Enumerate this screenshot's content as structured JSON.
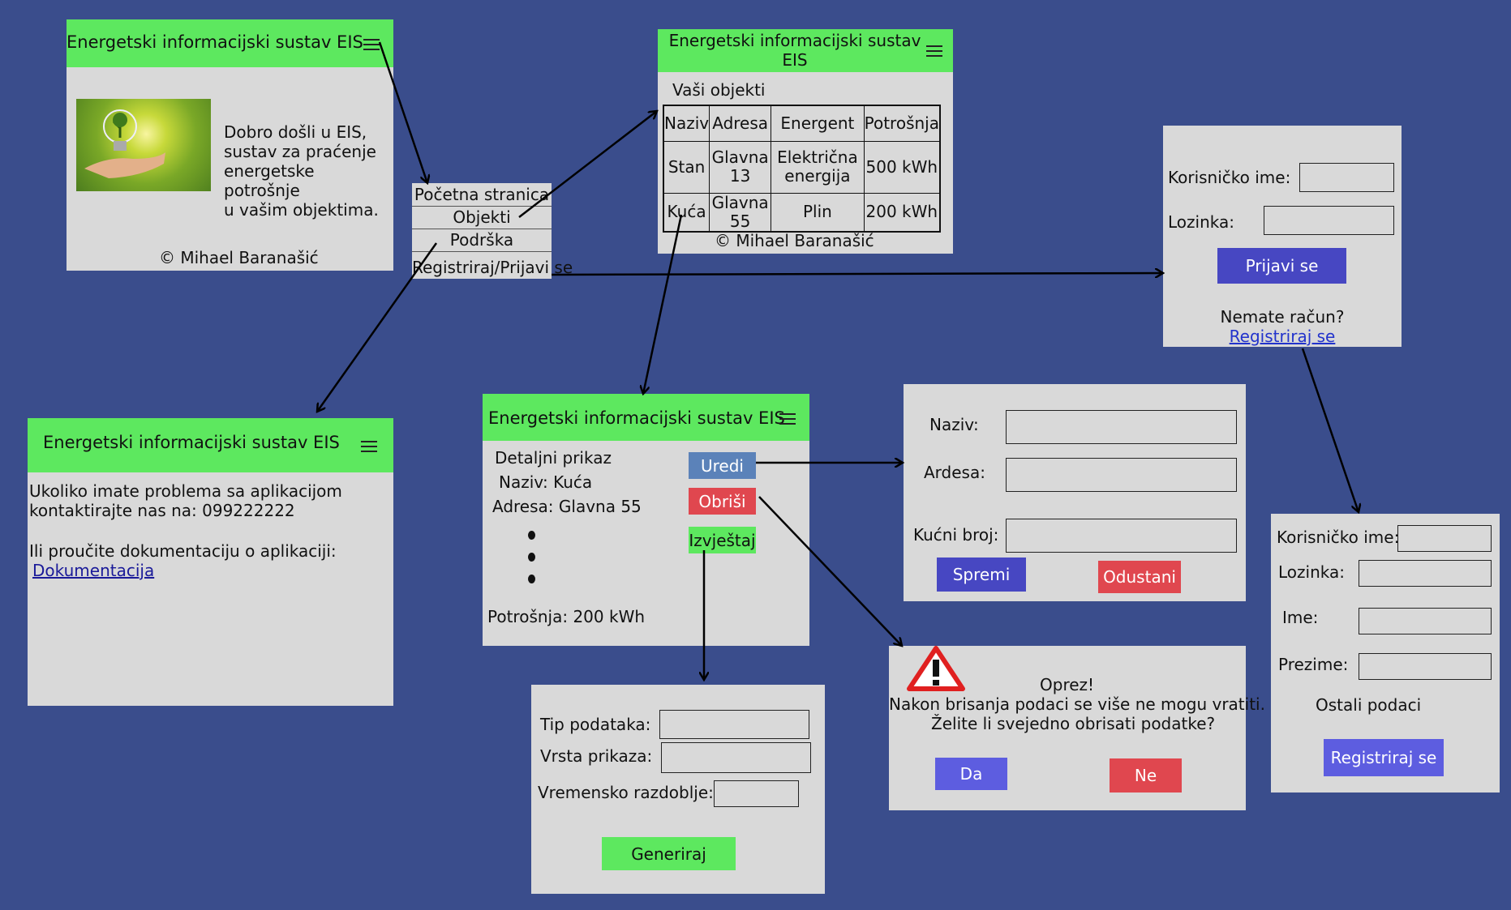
{
  "app_title": "Energetski informacijski sustav EIS",
  "copyright": "© Mihael Baranašić",
  "home": {
    "welcome": [
      "Dobro došli u EIS,",
      "sustav za praćenje",
      "energetske potrošnje",
      "u vašim objektima."
    ],
    "image_icon": "lightbulb-plant-image"
  },
  "nav_menu": {
    "items": [
      "Početna stranica",
      "Objekti",
      "Podrška",
      "Registriraj/Prijavi se"
    ]
  },
  "objects": {
    "title_line1": "Energetski informacijski sustav",
    "title_line2": "EIS",
    "heading": "Vaši objekti",
    "columns": [
      "Naziv",
      "Adresa",
      "Energent",
      "Potrošnja"
    ],
    "rows": [
      [
        "Stan",
        "Glavna 13",
        "Električna energija",
        "500 kWh"
      ],
      [
        "Kuća",
        "Glavna 55",
        "Plin",
        "200 kWh"
      ]
    ]
  },
  "login": {
    "username_label": "Korisničko ime:",
    "password_label": "Lozinka:",
    "submit": "Prijavi se",
    "no_account": "Nemate račun?",
    "register_link": "Registriraj se"
  },
  "support": {
    "line1": "Ukoliko imate problema sa aplikacijom",
    "line2": "kontaktirajte nas na: 099222222",
    "line3": "Ili proučite dokumentaciju o aplikaciji:",
    "doc_link": "Dokumentacija"
  },
  "detail": {
    "heading": "Detaljni prikaz",
    "name": "Naziv: Kuća",
    "address": "Adresa: Glavna 55",
    "consumption": "Potrošnja: 200 kWh",
    "edit": "Uredi",
    "delete": "Obriši",
    "report": "Izvještaj"
  },
  "edit_form": {
    "name_label": "Naziv:",
    "address_label": "Ardesa:",
    "house_no_label": "Kućni broj:",
    "save": "Spremi",
    "cancel": "Odustani"
  },
  "warning": {
    "title": "Oprez!",
    "line1": "Nakon brisanja podaci se više ne mogu vratiti.",
    "line2": "Želite li svejedno obrisati podatke?",
    "yes": "Da",
    "no": "Ne"
  },
  "register": {
    "username_label": "Korisničko ime:",
    "password_label": "Lozinka:",
    "first_name_label": "Ime:",
    "last_name_label": "Prezime:",
    "other": "Ostali podaci",
    "submit": "Registriraj se"
  },
  "report_form": {
    "type_label": "Tip podataka:",
    "view_label": "Vrsta prikaza:",
    "period_label": "Vremensko razdoblje:",
    "generate": "Generiraj"
  },
  "colors": {
    "background": "#3a4d8c",
    "panel": "#d9d9d9",
    "header_green": "#5de85f",
    "blue_button": "#4747c2",
    "steel_button": "#5b82b9",
    "red_button": "#e0474f",
    "purple_button": "#5d5de0"
  }
}
